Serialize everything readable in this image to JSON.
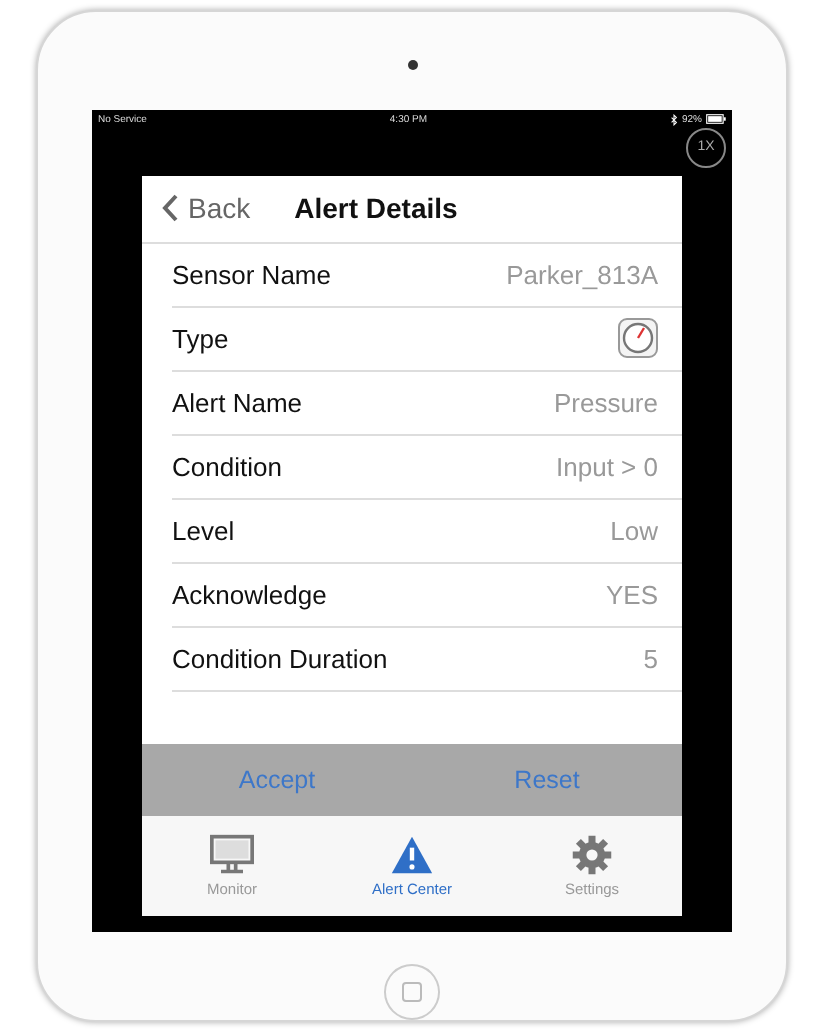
{
  "status_bar": {
    "carrier": "No Service",
    "time": "4:30 PM",
    "battery": "92%"
  },
  "zoom_badge": "1X",
  "nav": {
    "back": "Back",
    "title": "Alert Details"
  },
  "rows": [
    {
      "kind": "text",
      "label": "Sensor Name",
      "value": "Parker_813A"
    },
    {
      "kind": "gauge",
      "label": "Type"
    },
    {
      "kind": "text",
      "label": "Alert Name",
      "value": "Pressure"
    },
    {
      "kind": "text",
      "label": "Condition",
      "value": "Input > 0"
    },
    {
      "kind": "text",
      "label": "Level",
      "value": "Low"
    },
    {
      "kind": "text",
      "label": "Acknowledge",
      "value": "YES"
    },
    {
      "kind": "text",
      "label": "Condition Duration",
      "value": "5"
    }
  ],
  "actions": [
    "Accept",
    "Reset"
  ],
  "tabs": [
    {
      "kind": "monitor",
      "label": "Monitor",
      "selected": false
    },
    {
      "kind": "alert",
      "label": "Alert Center",
      "selected": true
    },
    {
      "kind": "settings",
      "label": "Settings",
      "selected": false
    }
  ]
}
